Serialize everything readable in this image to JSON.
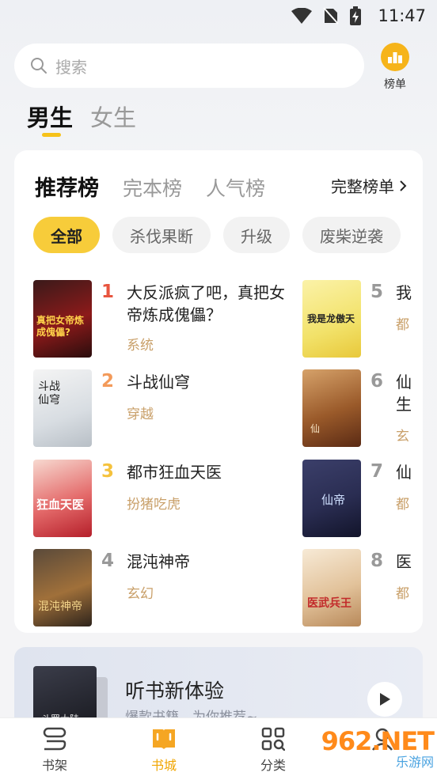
{
  "status_bar": {
    "time": "11:47"
  },
  "search": {
    "placeholder": "搜索"
  },
  "rank_button": {
    "label": "榜单"
  },
  "gender_tabs": [
    {
      "label": "男生",
      "active": true
    },
    {
      "label": "女生",
      "active": false
    }
  ],
  "rank_card": {
    "tabs": [
      {
        "label": "推荐榜",
        "active": true
      },
      {
        "label": "完本榜",
        "active": false
      },
      {
        "label": "人气榜",
        "active": false
      }
    ],
    "full_list_label": "完整榜单",
    "chips": [
      {
        "label": "全部",
        "active": true
      },
      {
        "label": "杀伐果断",
        "active": false
      },
      {
        "label": "升级",
        "active": false
      },
      {
        "label": "废柴逆袭",
        "active": false
      }
    ],
    "books_left": [
      {
        "rank": "1",
        "title": "大反派疯了吧，真把女帝炼成傀儡？",
        "tag": "系统",
        "cover_text": "真把女帝炼成傀儡?"
      },
      {
        "rank": "2",
        "title": "斗战仙穹",
        "tag": "穿越",
        "cover_text": "斗战仙穹"
      },
      {
        "rank": "3",
        "title": "都市狂血天医",
        "tag": "扮猪吃虎",
        "cover_text": "狂血天医"
      },
      {
        "rank": "4",
        "title": "混沌神帝",
        "tag": "玄幻",
        "cover_text": "混沌神帝"
      }
    ],
    "books_right": [
      {
        "rank": "5",
        "title": "我",
        "tag": "都",
        "cover_text": "我是龙傲天"
      },
      {
        "rank": "6",
        "title": "仙生",
        "tag": "玄",
        "cover_text": "仙"
      },
      {
        "rank": "7",
        "title": "仙",
        "tag": "都",
        "cover_text": "仙帝"
      },
      {
        "rank": "8",
        "title": "医",
        "tag": "都",
        "cover_text": "医武兵王"
      }
    ]
  },
  "audio_card": {
    "heading": "听书新体验",
    "subtitle": "爆款书籍，为你推荐~",
    "cover_text": "斗罗大陆"
  },
  "bottom_nav": [
    {
      "label": "书架",
      "active": false
    },
    {
      "label": "书城",
      "active": true
    },
    {
      "label": "分类",
      "active": false
    }
  ],
  "watermark": {
    "brand": "962.NET",
    "sub": "乐游网"
  }
}
